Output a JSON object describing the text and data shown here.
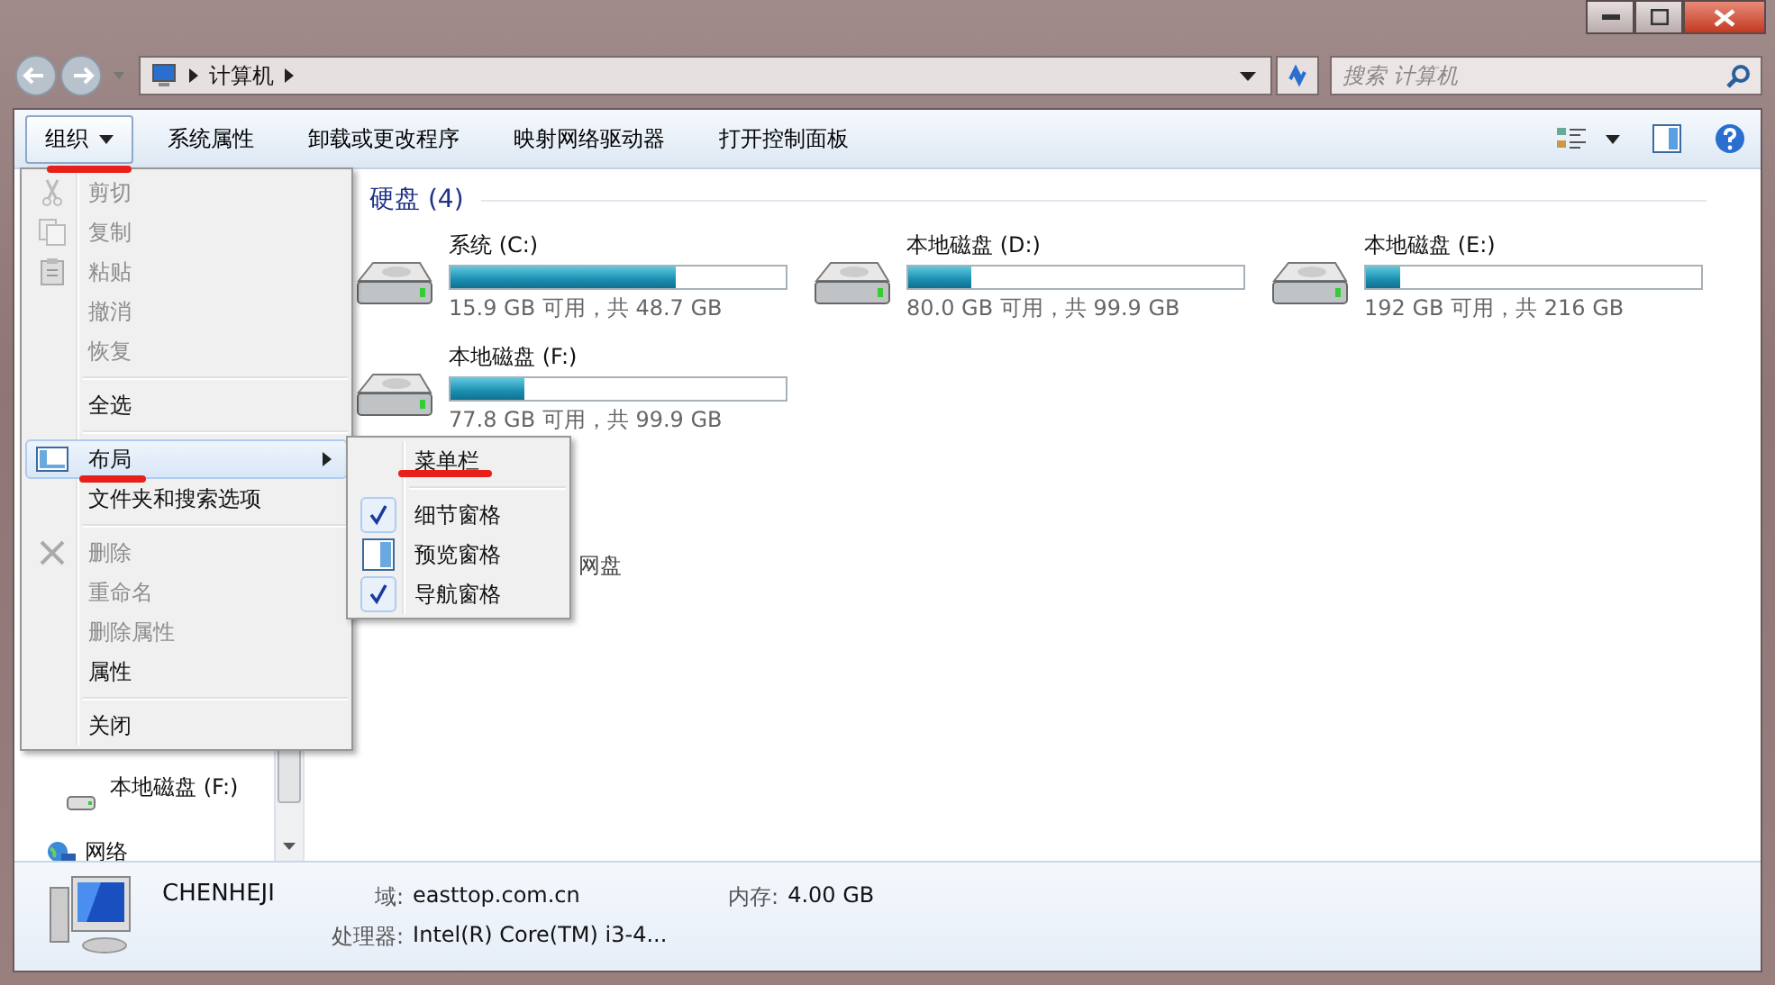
{
  "address": {
    "crumbs": [
      "计算机"
    ]
  },
  "search": {
    "placeholder": "搜索 计算机"
  },
  "toolbar": {
    "buttons": [
      {
        "label": "组织",
        "dropdown": true,
        "selected": true
      },
      {
        "label": "系统属性",
        "dropdown": false,
        "selected": false
      },
      {
        "label": "卸载或更改程序",
        "dropdown": false,
        "selected": false
      },
      {
        "label": "映射网络驱动器",
        "dropdown": false,
        "selected": false
      },
      {
        "label": "打开控制面板",
        "dropdown": false,
        "selected": false
      }
    ]
  },
  "nav_pane": {
    "items": [
      {
        "label": "本地磁盘 (F:)",
        "kind": "drive"
      },
      {
        "label": "网络",
        "kind": "network"
      }
    ]
  },
  "content": {
    "group_title": "硬盘 (4)",
    "side_text": "网盘",
    "drives": [
      {
        "name": "系统 (C:)",
        "level": 0.67,
        "space": "15.9 GB 可用，共 48.7 GB"
      },
      {
        "name": "本地磁盘 (D:)",
        "level": 0.19,
        "space": "80.0 GB 可用，共 99.9 GB"
      },
      {
        "name": "本地磁盘 (E:)",
        "level": 0.1,
        "space": "192 GB 可用，共 216 GB"
      },
      {
        "name": "本地磁盘 (F:)",
        "level": 0.22,
        "space": "77.8 GB 可用，共 99.9 GB"
      }
    ]
  },
  "menu": {
    "items": [
      {
        "kind": "item",
        "label": "剪切",
        "disabled": true,
        "selected": false,
        "submenu": false
      },
      {
        "kind": "item",
        "label": "复制",
        "disabled": true,
        "selected": false,
        "submenu": false
      },
      {
        "kind": "item",
        "label": "粘贴",
        "disabled": true,
        "selected": false,
        "submenu": false
      },
      {
        "kind": "item",
        "label": "撤消",
        "disabled": true,
        "selected": false,
        "submenu": false
      },
      {
        "kind": "item",
        "label": "恢复",
        "disabled": true,
        "selected": false,
        "submenu": false
      },
      {
        "kind": "separator"
      },
      {
        "kind": "item",
        "label": "全选",
        "disabled": false,
        "selected": false,
        "submenu": false
      },
      {
        "kind": "separator"
      },
      {
        "kind": "item",
        "label": "布局",
        "disabled": false,
        "selected": true,
        "submenu": true
      },
      {
        "kind": "item",
        "label": "文件夹和搜索选项",
        "disabled": false,
        "selected": false,
        "submenu": false
      },
      {
        "kind": "separator"
      },
      {
        "kind": "item",
        "label": "删除",
        "disabled": true,
        "selected": false,
        "submenu": false
      },
      {
        "kind": "item",
        "label": "重命名",
        "disabled": true,
        "selected": false,
        "submenu": false
      },
      {
        "kind": "item",
        "label": "删除属性",
        "disabled": true,
        "selected": false,
        "submenu": false
      },
      {
        "kind": "item",
        "label": "属性",
        "disabled": false,
        "selected": false,
        "submenu": false
      },
      {
        "kind": "separator"
      },
      {
        "kind": "item",
        "label": "关闭",
        "disabled": false,
        "selected": false,
        "submenu": false
      }
    ]
  },
  "submenu": {
    "items": [
      {
        "kind": "item",
        "label": "菜单栏",
        "checked": false
      },
      {
        "kind": "separator"
      },
      {
        "kind": "item",
        "label": "细节窗格",
        "checked": true
      },
      {
        "kind": "item",
        "label": "预览窗格",
        "checked": false
      },
      {
        "kind": "item",
        "label": "导航窗格",
        "checked": true
      }
    ]
  },
  "details": {
    "computer_name": "CHENHEJI",
    "domain_label": "域:",
    "domain": "easttop.com.cn",
    "memory_label": "内存:",
    "memory": "4.00 GB",
    "cpu_label": "处理器:",
    "cpu": "Intel(R) Core(TM) i3-4..."
  }
}
